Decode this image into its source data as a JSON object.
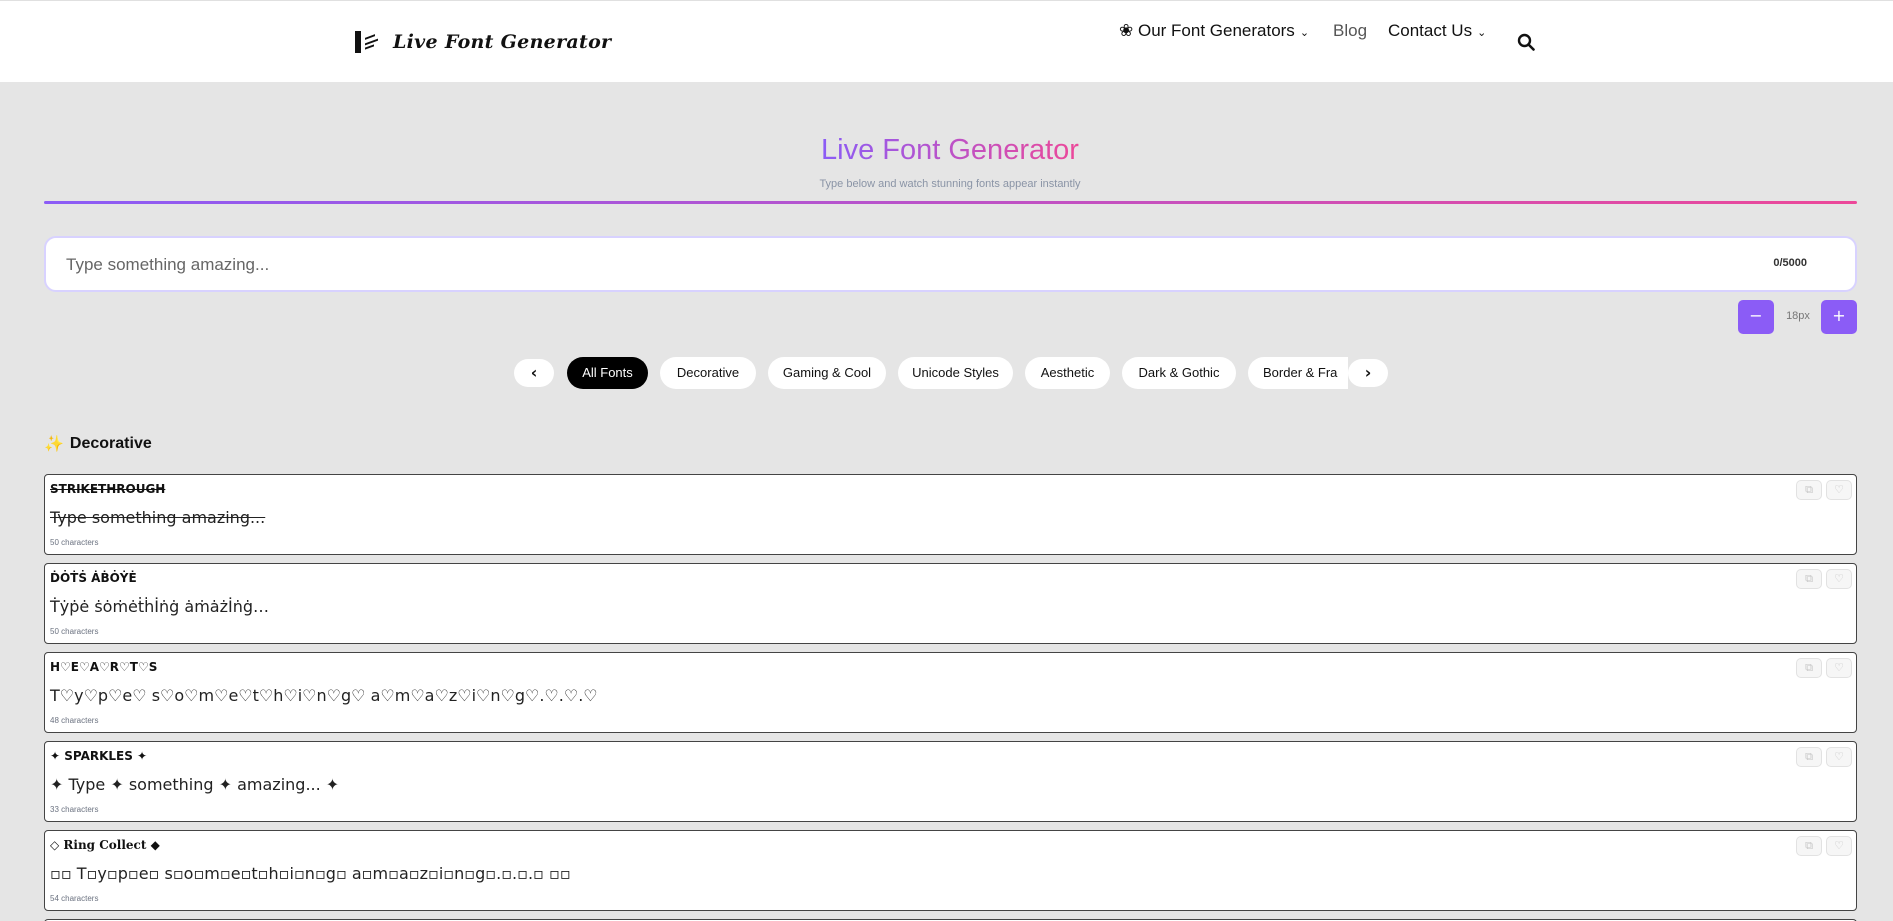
{
  "header": {
    "logo_text": "Live Font Generator",
    "nav": [
      {
        "label": "❀ Our Font Generators",
        "has_dropdown": true
      },
      {
        "label": "Blog",
        "has_dropdown": false
      },
      {
        "label": "Contact Us",
        "has_dropdown": true
      }
    ],
    "search_icon": "search-icon"
  },
  "hero": {
    "title": "Live Font Generator",
    "subtitle": "Type below and watch stunning fonts appear instantly",
    "gradient": [
      "#8b5cf6",
      "#ec4899"
    ]
  },
  "input": {
    "placeholder": "Type something amazing...",
    "value": "",
    "char_count": "0/5000"
  },
  "size_control": {
    "minus": "−",
    "value": "18px",
    "plus": "+",
    "accent": "#8b5cf6"
  },
  "categories": {
    "prev": "‹",
    "next": "›",
    "items": [
      "All Fonts",
      "Decorative",
      "Gaming & Cool",
      "Unicode Styles",
      "Aesthetic",
      "Dark & Gothic",
      "Border & Fra"
    ],
    "active": "All Fonts"
  },
  "section": {
    "icon": "sparkle-icon",
    "title": "Decorative"
  },
  "cards": [
    {
      "title": "STRIKETHROUGH",
      "preview": "Type something amazing...",
      "count": "50 characters"
    },
    {
      "title": "ḊȮṪṠ ȦḂȮẎĖ",
      "preview": "Ṫẏṗė ṡȯṁėṫḣİṅġ ȧṁȧżİṅġ…",
      "count": "50 characters"
    },
    {
      "title": "H♡E♡A♡R♡T♡S",
      "preview": "T♡y♡p♡e♡ s♡o♡m♡e♡t♡h♡i♡n♡g♡ a♡m♡a♡z♡i♡n♡g♡.♡.♡.♡",
      "count": "48 characters"
    },
    {
      "title": "✦ SPARKLES ✦",
      "preview": "✦ Type ✦ something ✦ amazing... ✦",
      "count": "33 characters"
    },
    {
      "title": "◇ Ring Collect ◆",
      "preview": "▫▫ T▫y▫p▫e▫ s▫o▫m▫e▫t▫h▫i▫n▫g▫ a▫m▫a▫z▫i▫n▫g▫.▫.▫.▫ ▫▫",
      "count": "54 characters"
    }
  ],
  "card_icons": [
    "copy-icon",
    "heart-icon"
  ]
}
